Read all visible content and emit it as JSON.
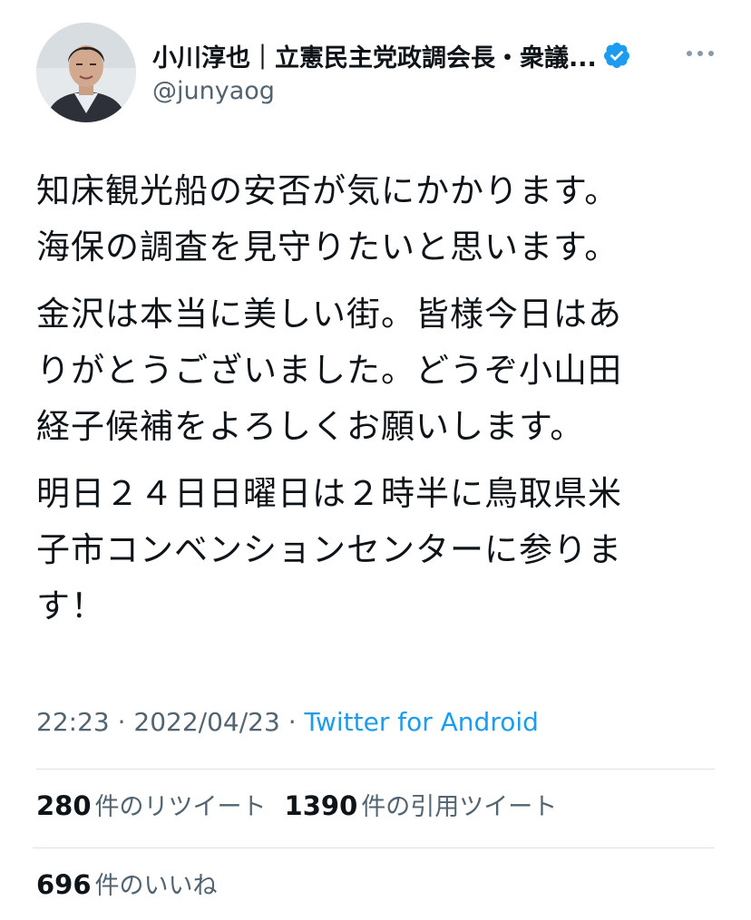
{
  "author": {
    "display_name": "小川淳也｜立憲民主党政調会長・衆議...",
    "handle": "@junyaog",
    "verified_color": "#1d9bf0"
  },
  "tweet": {
    "paragraphs": [
      "知床観光船の安否が気にかかります。\n海保の調査を見守りたいと思います。",
      "金沢は本当に美しい街。皆様今日はあ\nりがとうございました。どうぞ小山田\n経子候補をよろしくお願いします。",
      "明日２４日日曜日は２時半に鳥取県米\n子市コンベンションセンターに参りま\nす！"
    ],
    "time": "22:23",
    "date": "2022/04/23",
    "separator": " · ",
    "source": "Twitter for Android"
  },
  "stats": {
    "retweets_count": "280",
    "retweets_label": "件のリツイート",
    "quotes_count": "1390",
    "quotes_label": "件の引用ツイート",
    "likes_count": "696",
    "likes_label": "件のいいね"
  },
  "icons": {
    "verified": "verified-badge-icon",
    "more": "more-options-icon"
  }
}
